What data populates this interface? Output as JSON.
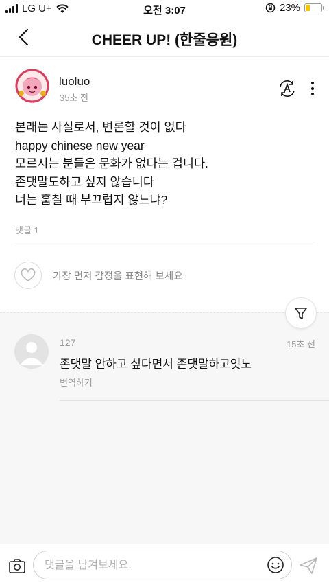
{
  "status_bar": {
    "carrier": "LG U+",
    "time": "오전 3:07",
    "battery": "23%",
    "battery_level": 0.23
  },
  "header": {
    "title": "CHEER UP! (한줄응원)"
  },
  "post": {
    "author": "luoluo",
    "time_ago": "35초 전",
    "lines": [
      "본래는 사실로서, 변론할 것이 없다",
      "happy chinese new year",
      "모르시는 분들은 문화가 없다는 겁니다.",
      "존댓말도하고 싶지 않습니다",
      "너는 훔칠 때 부끄럽지 않느냐?"
    ],
    "comment_count": "댓글 1",
    "reaction_prompt": "가장 먼저 감정을 표현해 보세요."
  },
  "comments": [
    {
      "author": "127",
      "time_ago": "15초 전",
      "text": "존댓말 안하고 싶다면서 존댓말하고잇노",
      "translate_label": "번역하기"
    }
  ],
  "comment_input": {
    "placeholder": "댓글을 남겨보세요."
  },
  "icons": {
    "back": "chevron-left-icon",
    "translate": "translate-icon",
    "more": "more-vertical-icon",
    "heart": "heart-icon",
    "filter": "filter-icon",
    "camera": "camera-icon",
    "emoji": "smiley-icon",
    "send": "send-icon"
  }
}
